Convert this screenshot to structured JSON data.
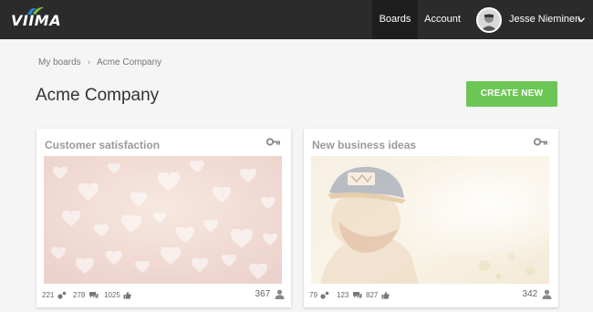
{
  "app": {
    "logo_text": "VIIMA",
    "brand_accent": "#6cc655"
  },
  "nav": {
    "boards_label": "Boards",
    "account_label": "Account",
    "user_name": "Jesse Nieminen"
  },
  "breadcrumb": {
    "parent": "My boards",
    "current": "Acme Company"
  },
  "page": {
    "title": "Acme Company",
    "create_label": "CREATE NEW"
  },
  "boards": [
    {
      "title": "Customer satisfaction",
      "ideas": "221",
      "comments": "278",
      "likes": "1025",
      "users": "367",
      "image": "pink-hearts-bokeh",
      "private_icon": "key-icon"
    },
    {
      "title": "New business ideas",
      "ideas": "79",
      "comments": "123",
      "likes": "827",
      "users": "342",
      "image": "man-in-cap-sunset",
      "private_icon": "key-icon"
    }
  ]
}
